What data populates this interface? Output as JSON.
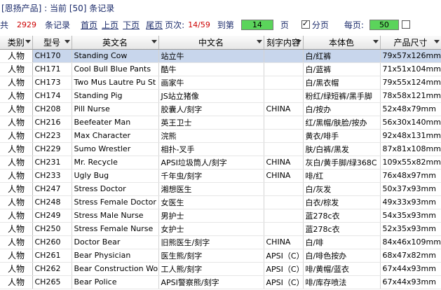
{
  "title": "[恩扬产品] : 当前 [50] 条记录",
  "toolbar": {
    "total_prefix": "共",
    "total_count": "2929",
    "total_suffix": "条记录",
    "first_page": "首页",
    "prev_page": "上页",
    "next_page": "下页",
    "last_page": "尾页",
    "page_label": "页次:",
    "page_info": "14/59",
    "goto_label": "到第",
    "goto_value": "14",
    "page_unit": "页",
    "paging_label": "分页",
    "paging_checked": true,
    "per_page_label": "每页:",
    "per_page_value": "50"
  },
  "columns": [
    "类别",
    "型号",
    "英文名",
    "中文名",
    "刻字内容",
    "本体色",
    "产品尺寸"
  ],
  "rows": [
    [
      "人物",
      "CH170",
      "Standing Cow",
      "站立牛",
      "",
      "白/红裤",
      "79x57x126mm"
    ],
    [
      "人物",
      "CH171",
      "Cool Bull Blue Pants",
      "酷牛",
      "",
      "白/蓝裤",
      "71x51x104mm"
    ],
    [
      "人物",
      "CH173",
      "Two Mus Lautre Pu St",
      "画家牛",
      "",
      "白/黑衣帽",
      "79x55x124mm"
    ],
    [
      "人物",
      "CH174",
      "Standing Pig",
      "JS站立猪像",
      "",
      "粉红/绿短裤/黑手脚",
      "78x58x121mm"
    ],
    [
      "人物",
      "CH208",
      "Pill Nurse",
      "胶囊人/刻字",
      "CHINA",
      "白/按办",
      "52x48x79mm"
    ],
    [
      "人物",
      "CH216",
      "Beefeater Man",
      "英王卫士",
      "",
      "红/黑帽/肤脸/按办",
      "56x30x140mm"
    ],
    [
      "人物",
      "CH223",
      "Max Character",
      "浣熊",
      "",
      "黄衣/啡手",
      "92x48x131mm"
    ],
    [
      "人物",
      "CH229",
      "Sumo Wrestler",
      "相扑-叉手",
      "",
      "肤/白裤/黑发",
      "87x81x108mm"
    ],
    [
      "人物",
      "CH231",
      "Mr. Recycle",
      "APSI垃圾筒人/刻字",
      "CHINA",
      "灰白/黄手脚/绿368C",
      "109x55x82mm"
    ],
    [
      "人物",
      "CH233",
      "Ugly Bug",
      "千年虫/刻字",
      "CHINA",
      "啡/红",
      "76x48x97mm"
    ],
    [
      "人物",
      "CH247",
      "Stress Doctor",
      "湘想医生",
      "",
      "白/灰发",
      "50x37x93mm"
    ],
    [
      "人物",
      "CH248",
      "Stress Female Doctor",
      "女医生",
      "",
      "白衣/棕发",
      "49x33x93mm"
    ],
    [
      "人物",
      "CH249",
      "Stress Male Nurse",
      "男护士",
      "",
      "蓝278c衣",
      "54x35x93mm"
    ],
    [
      "人物",
      "CH250",
      "Stress Female Nurse",
      "女护士",
      "",
      "蓝278c衣",
      "52x35x93mm"
    ],
    [
      "人物",
      "CH260",
      "Doctor Bear",
      "旧熊医生/刻字",
      "CHINA",
      "白/啡",
      "84x46x109mm"
    ],
    [
      "人物",
      "CH261",
      "Bear Physician",
      "医生熊/刻字",
      "APSI（C）",
      "白/啡色按办",
      "68x47x82mm"
    ],
    [
      "人物",
      "CH262",
      "Bear Construction Wo",
      "工人熊/刻字",
      "APSI（C）",
      "啡/黄帽/蓝衣",
      "67x44x93mm"
    ],
    [
      "人物",
      "CH265",
      "Bear Police",
      "APSI警察熊/刻字",
      "APSI（C）",
      "啡/库存喷法",
      "67x44x93mm"
    ]
  ]
}
